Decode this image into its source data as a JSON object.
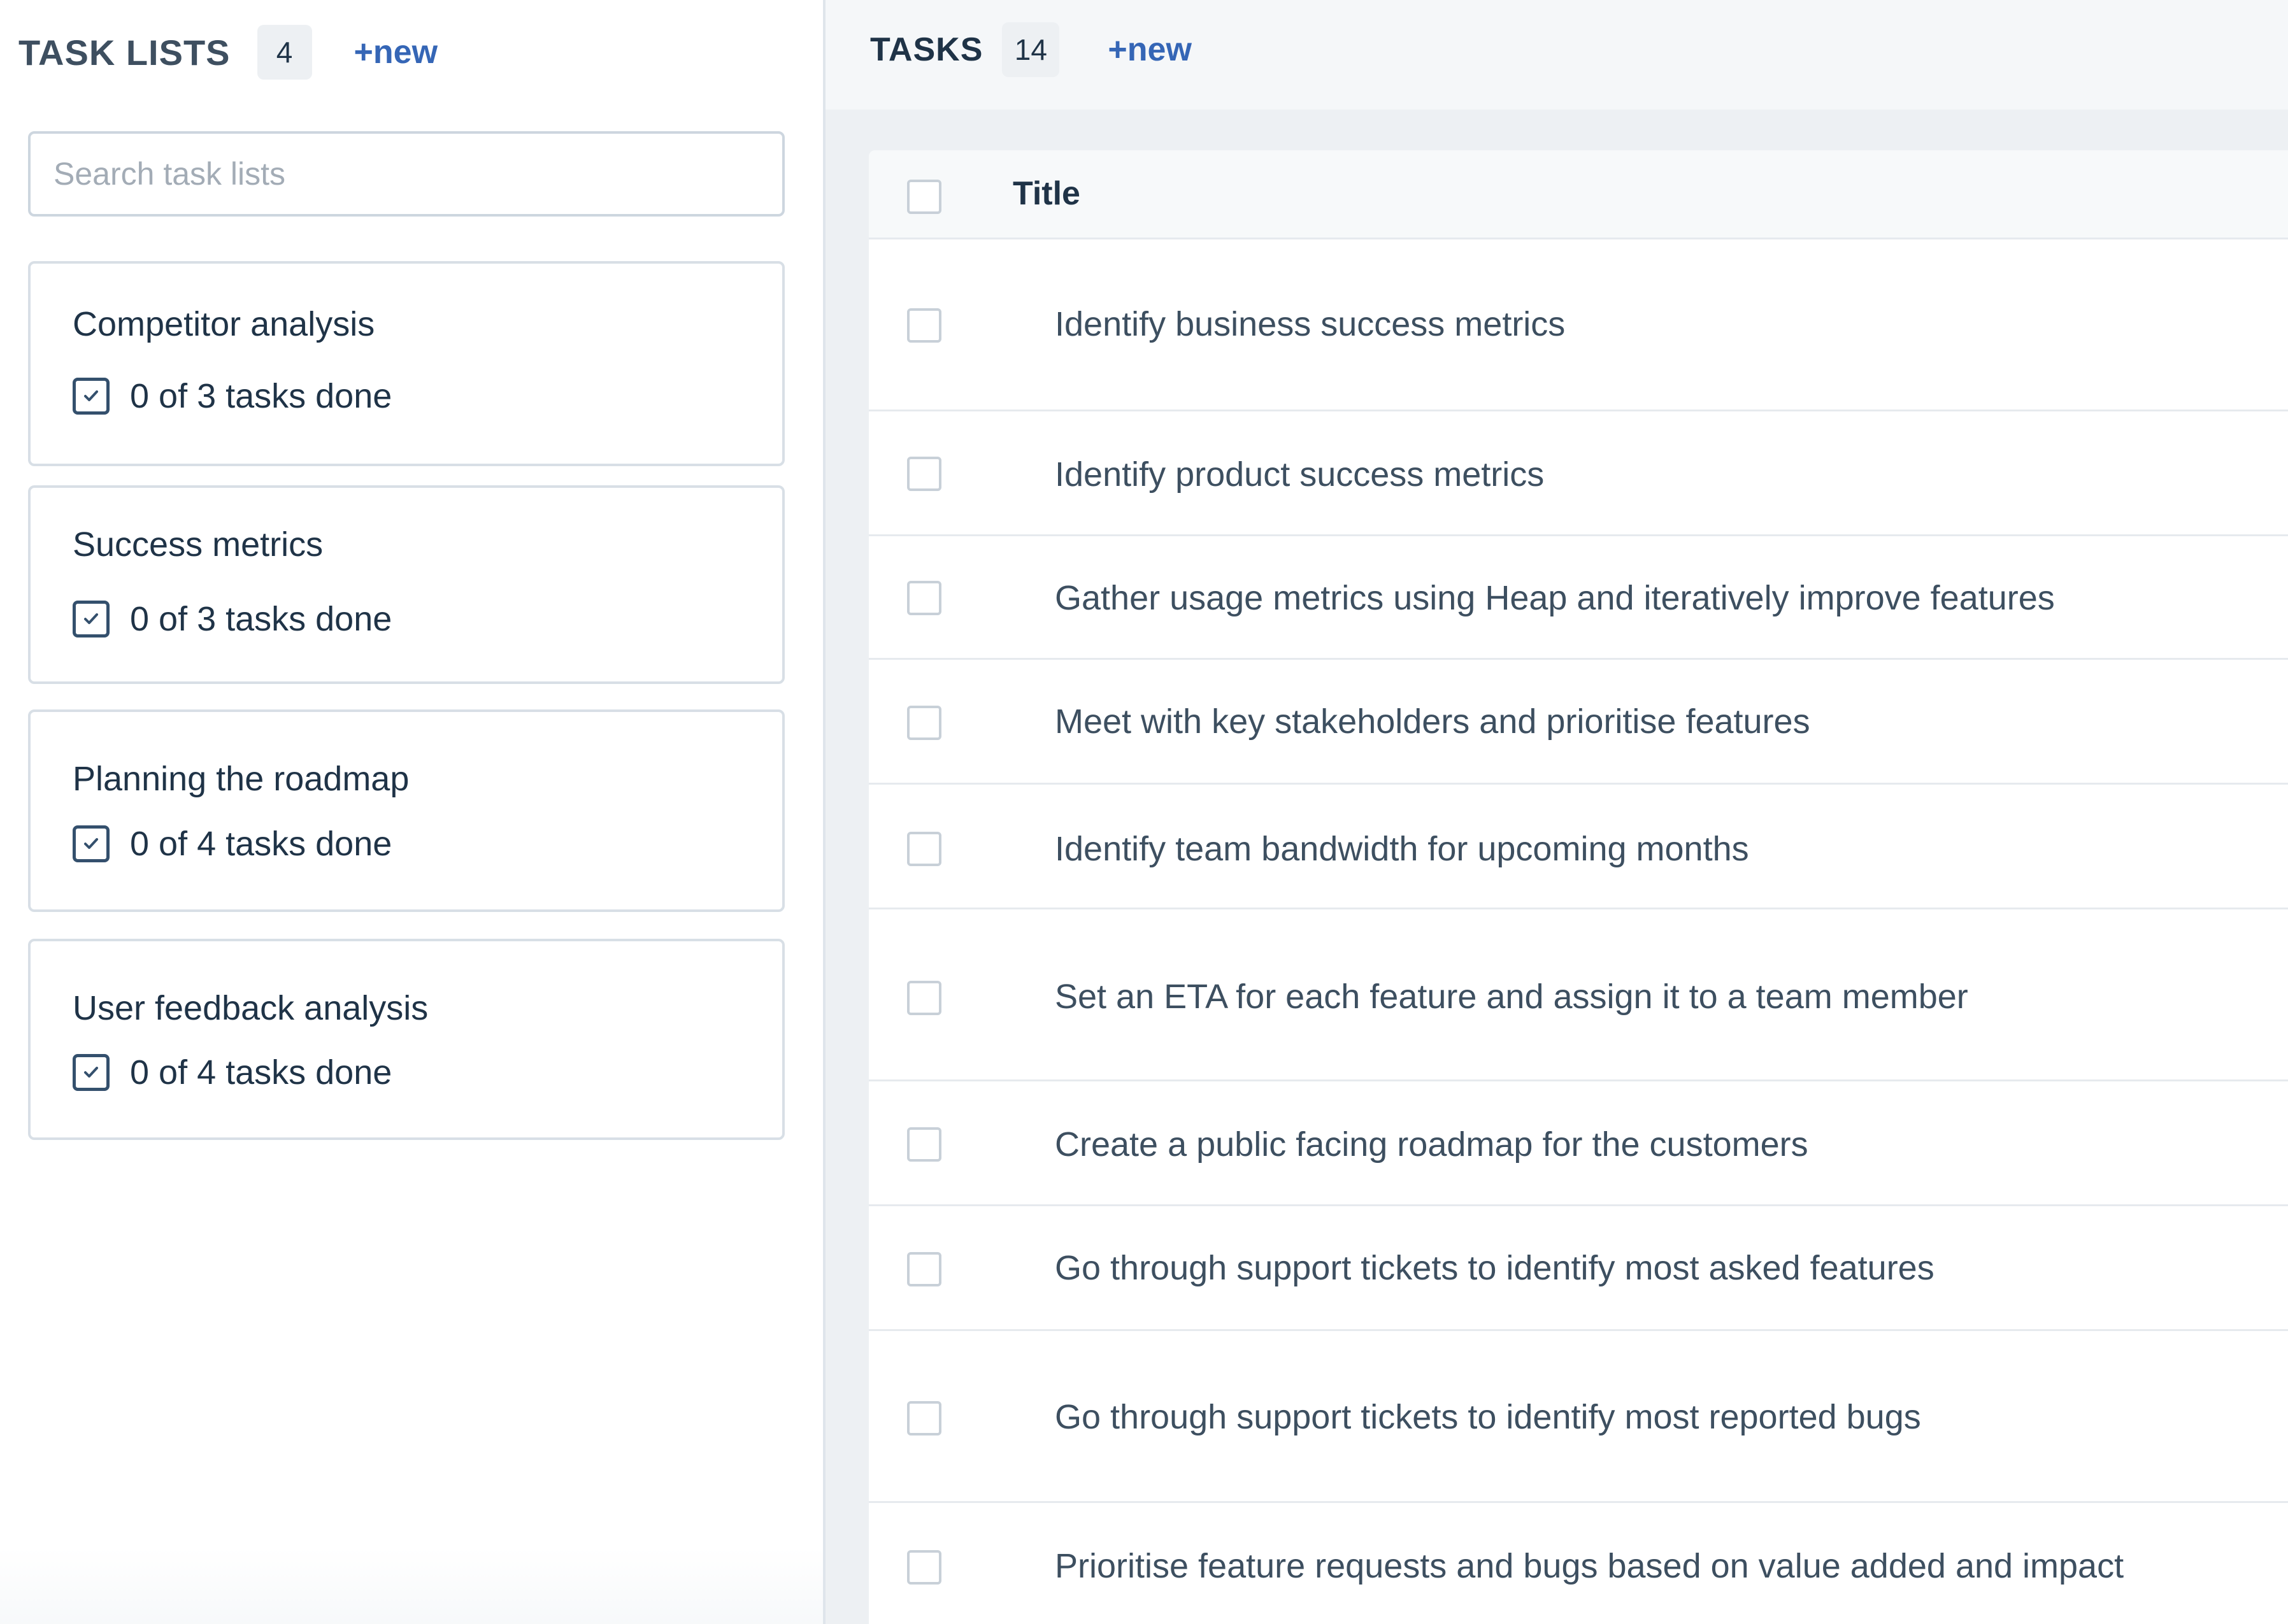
{
  "task_lists_panel": {
    "title": "TASK LISTS",
    "count": "4",
    "new_label": "+new",
    "search_placeholder": "Search task lists",
    "lists": [
      {
        "name": "Competitor analysis",
        "progress": "0 of 3 tasks done"
      },
      {
        "name": "Success metrics",
        "progress": "0 of 3 tasks done"
      },
      {
        "name": "Planning the roadmap",
        "progress": "0 of 4 tasks done"
      },
      {
        "name": "User feedback analysis",
        "progress": "0 of 4 tasks done"
      }
    ]
  },
  "tasks_panel": {
    "title": "TASKS",
    "count": "14",
    "new_label": "+new",
    "column_title": "Title",
    "tasks": [
      "Identify business success metrics",
      "Identify product success metrics",
      "Gather usage metrics using Heap and iteratively improve features",
      "Meet with key stakeholders and prioritise features",
      "Identify team bandwidth for upcoming months",
      "Set an ETA for each feature and assign it to a team member",
      "Create a public facing roadmap for the customers",
      "Go through support tickets to identify most asked features",
      "Go through support tickets to identify most reported bugs",
      "Prioritise feature requests and bugs based on value added and impact"
    ]
  },
  "icons": {
    "progress": "checkbox-checked-icon",
    "row_select": "checkbox-icon"
  },
  "colors": {
    "accent_link": "#3566b6",
    "text": "#1f3347",
    "panel_bg": "#edf0f3"
  }
}
